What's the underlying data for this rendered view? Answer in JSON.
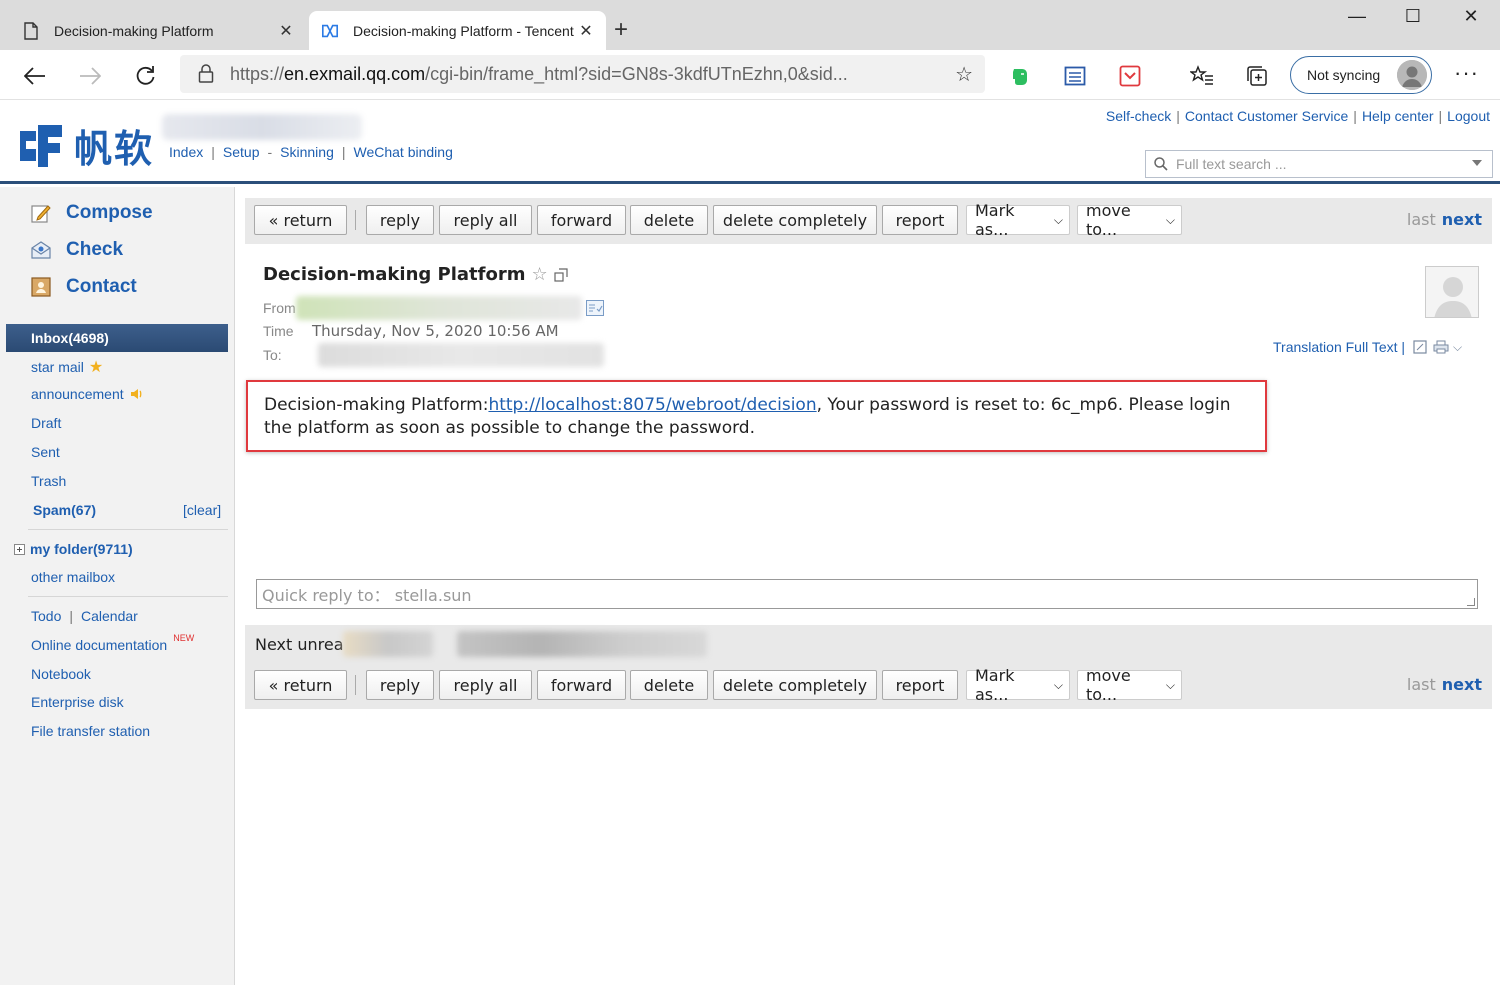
{
  "browser": {
    "tabs": [
      {
        "title": "Decision-making Platform",
        "active": false
      },
      {
        "title": "Decision-making Platform - Tencent Exmail",
        "active": true
      }
    ],
    "url_prefix": "https://",
    "url_host": "en.exmail.qq.com",
    "url_path": "/cgi-bin/frame_html?sid=GN8s-3kdfUTnEzhn,0&sid...",
    "sync_label": "Not syncing"
  },
  "header": {
    "brand": "帆软",
    "nav": [
      "Index",
      "Setup",
      "Skinning",
      "WeChat binding"
    ],
    "links": [
      "Self-check",
      "Contact Customer Service",
      "Help center",
      "Logout"
    ],
    "search_placeholder": "Full text search ..."
  },
  "sidebar": {
    "compose": "Compose",
    "check": "Check",
    "contact": "Contact",
    "inbox": "Inbox(4698)",
    "star_mail": "star mail",
    "announcement": "announcement",
    "draft": "Draft",
    "sent": "Sent",
    "trash": "Trash",
    "spam": "Spam(67)",
    "clear": "[clear]",
    "my_folder": "my folder(9711)",
    "other_mailbox": "other mailbox",
    "todo": "Todo",
    "calendar": "Calendar",
    "online_doc": "Online documentation",
    "new_badge": "NEW",
    "notebook": "Notebook",
    "enterprise_disk": "Enterprise disk",
    "file_transfer": "File transfer station"
  },
  "actions": {
    "return": "« return",
    "reply": "reply",
    "reply_all": "reply all",
    "forward": "forward",
    "delete": "delete",
    "delete_completely": "delete completely",
    "report": "report",
    "mark_as": "Mark as...",
    "move_to": "move to...",
    "last": "last",
    "next": "next"
  },
  "mail": {
    "subject": "Decision-making Platform",
    "from_label": "From",
    "time_label": "Time",
    "time_value": "Thursday, Nov 5, 2020 10:56 AM",
    "to_label": "To:",
    "translation": "Translation Full Text |",
    "body_prefix": "Decision-making Platform:",
    "body_link": "http://localhost:8075/webroot/decision",
    "body_suffix": ",  Your password is reset to: 6c_mp6. Please login the platform as soon as possible to change the password.",
    "quick_reply": "Quick reply to：  stella.sun",
    "next_unread": "Next unread"
  }
}
